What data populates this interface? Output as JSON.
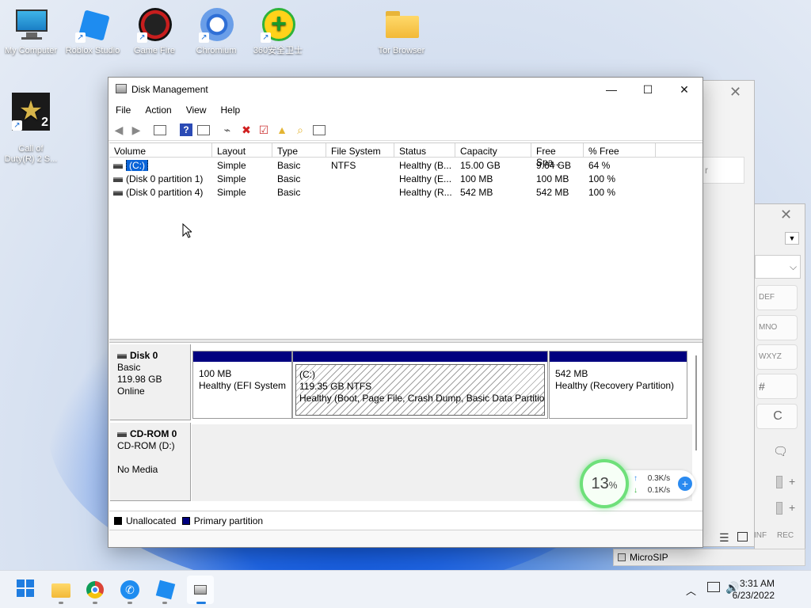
{
  "desktop": {
    "icons": [
      {
        "label": "My Computer",
        "icon": "monitor-icon"
      },
      {
        "label": "Roblox Studio",
        "icon": "roblox-icon"
      },
      {
        "label": "Game Fire",
        "icon": "gamefire-icon"
      },
      {
        "label": "Chromium",
        "icon": "chromium-icon"
      },
      {
        "label": "360安全卫士",
        "icon": "360-icon"
      },
      {
        "label": "Tor Browser",
        "icon": "folder-icon"
      },
      {
        "label": "Call of\nDuty(R) 2 S...",
        "icon": "cod-icon"
      }
    ]
  },
  "background_windows": {
    "microsip_label": "MicroSIP",
    "keys": [
      "DEF",
      "MNO",
      "WXYZ",
      "#",
      "C"
    ],
    "field_fragment": "r",
    "bottom_labels": [
      "INF",
      "REC"
    ]
  },
  "window": {
    "title": "Disk Management",
    "controls": {
      "minimize": "—",
      "maximize": "☐",
      "close": "✕"
    }
  },
  "menu": [
    "File",
    "Action",
    "View",
    "Help"
  ],
  "volume_table": {
    "columns": [
      "Volume",
      "Layout",
      "Type",
      "File System",
      "Status",
      "Capacity",
      "Free Spa...",
      "% Free"
    ],
    "rows": [
      {
        "volume": "(C:)",
        "layout": "Simple",
        "type": "Basic",
        "fs": "NTFS",
        "status": "Healthy (B...",
        "capacity": "15.00 GB",
        "free": "9.64 GB",
        "pct": "64 %"
      },
      {
        "volume": "(Disk 0 partition 1)",
        "layout": "Simple",
        "type": "Basic",
        "fs": "",
        "status": "Healthy (E...",
        "capacity": "100 MB",
        "free": "100 MB",
        "pct": "100 %"
      },
      {
        "volume": "(Disk 0 partition 4)",
        "layout": "Simple",
        "type": "Basic",
        "fs": "",
        "status": "Healthy (R...",
        "capacity": "542 MB",
        "free": "542 MB",
        "pct": "100 %"
      }
    ]
  },
  "disks": {
    "disk0": {
      "name": "Disk 0",
      "type": "Basic",
      "size": "119.98 GB",
      "state": "Online"
    },
    "partitions": [
      {
        "line1": "",
        "line2": "100 MB",
        "line3": "Healthy (EFI System P"
      },
      {
        "line1": "(C:)",
        "line2": "119.35 GB NTFS",
        "line3": "Healthy (Boot, Page File, Crash Dump, Basic Data Partition"
      },
      {
        "line1": "",
        "line2": "542 MB",
        "line3": "Healthy (Recovery Partition)"
      }
    ],
    "cdrom": {
      "name": "CD-ROM 0",
      "drive": "CD-ROM (D:)",
      "media": "No Media"
    }
  },
  "legend": {
    "unallocated": "Unallocated",
    "primary": "Primary partition",
    "unallocated_color": "#000000",
    "primary_color": "#00007f"
  },
  "netmon": {
    "percent": "13",
    "percent_sign": "%",
    "up": "0.3K/s",
    "down": "0.1K/s"
  },
  "taskbar": {
    "time": "3:31 AM",
    "date": "6/23/2022"
  }
}
